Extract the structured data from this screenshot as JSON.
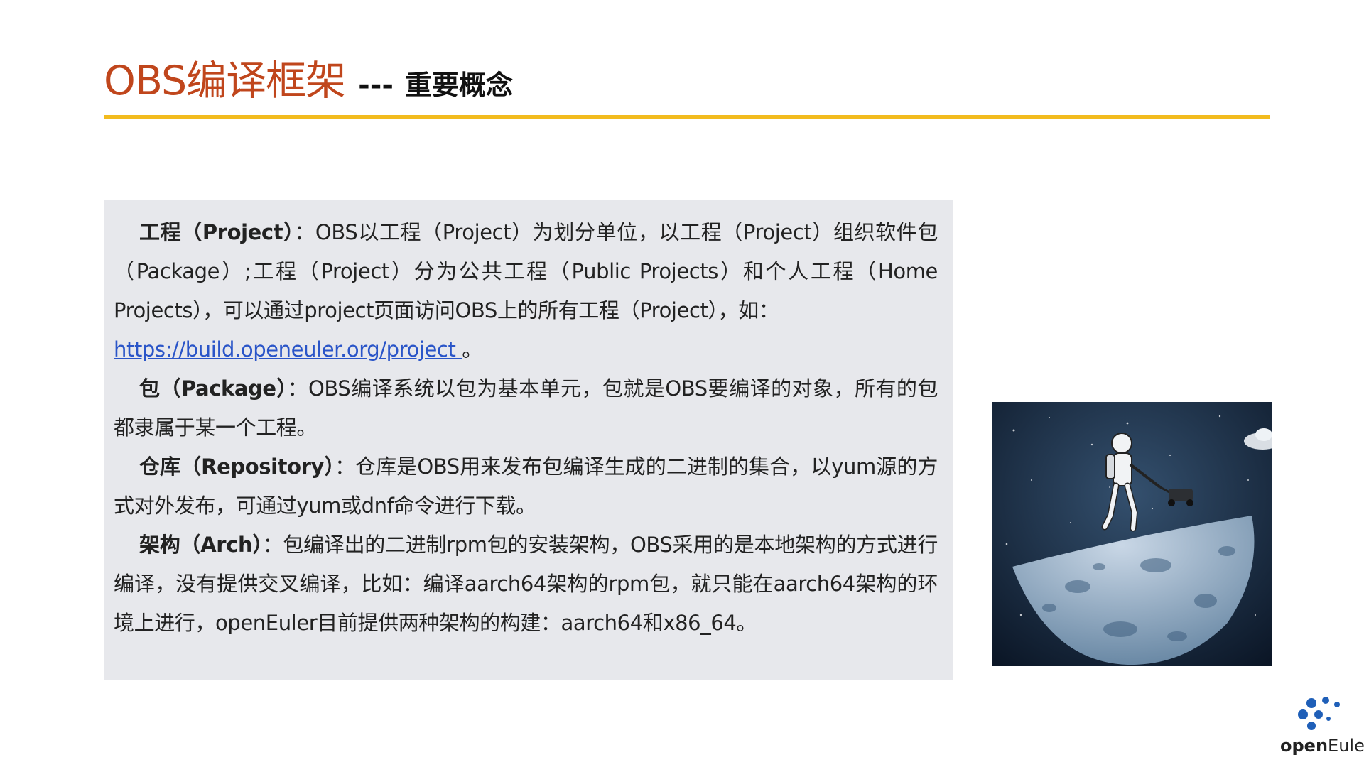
{
  "header": {
    "title": "OBS编译框架",
    "separator": "---",
    "subtitle": "重要概念"
  },
  "content": {
    "project": {
      "term": "工程（Project）",
      "colon": "：",
      "text": "OBS以工程（Project）为划分单位，以工程（Project）组织软件包（Package）;工程（Project）分为公共工程（Public Projects）和个人工程（Home Projects），可以通过project页面访问OBS上的所有工程（Project），如：",
      "link": "https://build.openeuler.org/project ",
      "end": "。"
    },
    "package": {
      "term": "包（Package）",
      "colon": "：",
      "text": "OBS编译系统以包为基本单元，包就是OBS要编译的对象，所有的包都隶属于某一个工程。"
    },
    "repository": {
      "term": "仓库（Repository）",
      "colon": "：",
      "text": "仓库是OBS用来发布包编译生成的二进制的集合，以yum源的方式对外发布，可通过yum或dnf命令进行下载。"
    },
    "arch": {
      "term": "架构（Arch）",
      "colon": "：",
      "text": "包编译出的二进制rpm包的安装架构，OBS采用的是本地架构的方式进行编译，没有提供交叉编译，比如：编译aarch64架构的rpm包，就只能在aarch64架构的环境上进行，openEuler目前提供两种架构的构建：aarch64和x86_64。"
    }
  },
  "logo": {
    "prefix": "open",
    "suffix": "Euler"
  },
  "colors": {
    "title": "#c0461c",
    "rule": "#f2bb1e",
    "box": "#e7e8ec",
    "link": "#2a55c8",
    "logo": "#1f5fb8"
  }
}
